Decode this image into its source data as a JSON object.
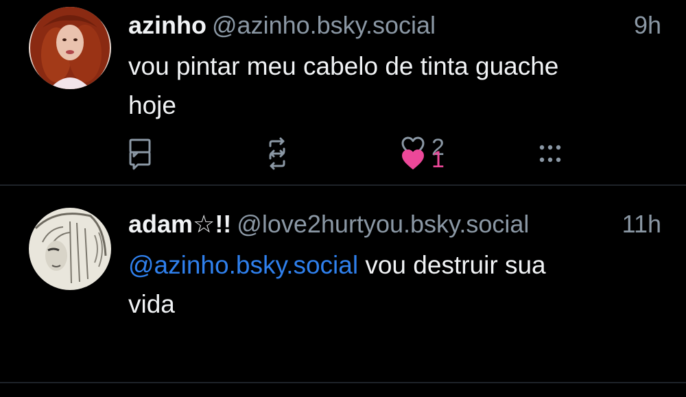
{
  "posts": [
    {
      "display_name": "azinho",
      "handle": "@azinho.bsky.social",
      "time": "9h",
      "mention": "",
      "text_line1": "vou pintar meu cabelo de tinta guache",
      "text_line2": "hoje",
      "like_count": "2",
      "liked": false,
      "avatar_icon": "avatar-red-hair-woman"
    },
    {
      "display_name": "adam☆!!",
      "handle": "@love2hurtyou.bsky.social",
      "time": "11h",
      "mention": "@azinho.bsky.social",
      "text_line1": " vou destruir sua",
      "text_line2": "vida",
      "like_count": "1",
      "liked": true,
      "avatar_icon": "avatar-anime-sketch"
    }
  ],
  "colors": {
    "background": "#000000",
    "text": "#f1f3f5",
    "muted": "#8b98a5",
    "mention": "#2f80ed",
    "like_active": "#ec4899",
    "divider": "#1e2329"
  },
  "icons": {
    "reply": "reply-icon",
    "repost": "repost-icon",
    "like": "heart-icon",
    "more": "more-icon"
  }
}
